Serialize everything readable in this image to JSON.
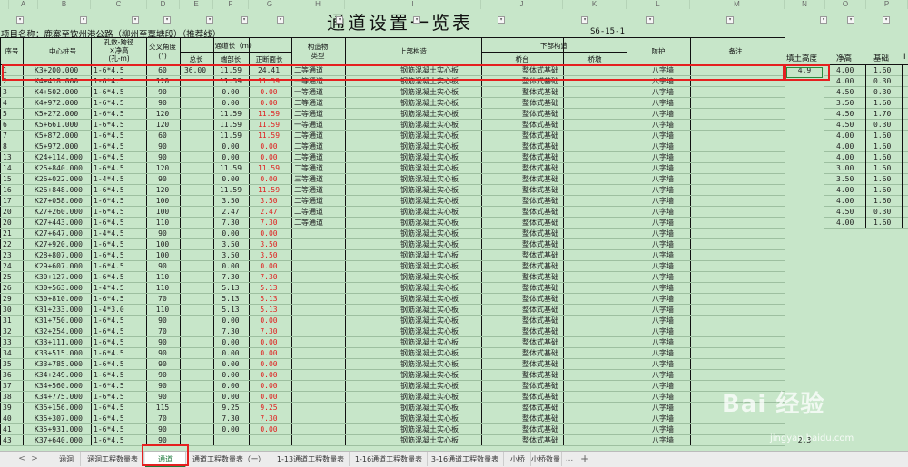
{
  "column_letters": [
    "A",
    "B",
    "C",
    "D",
    "E",
    "F",
    "G",
    "H",
    "I",
    "J",
    "K",
    "L",
    "M",
    "N",
    "O",
    "P"
  ],
  "title": "通道设置一览表",
  "project_label": "项目名称：鹿寨至钦州港公路（柳州至覃塘段）（推荐线）",
  "sheet_code": "S6-15-1",
  "headers": {
    "no": "序号",
    "station": "中心桩号",
    "span_l1": "孔数-跨径",
    "span_l2": "×净高",
    "span_l3": "(孔-m)",
    "angle_l1": "交叉角度",
    "angle_l2": "(°)",
    "length_group": "通道长（m）",
    "total": "总长",
    "mid": "端部长",
    "side": "正断面长",
    "type_l1": "构造物",
    "type_l2": "类型",
    "super": "上部构造",
    "sub_group": "下部构造",
    "abut": "桥台",
    "pier": "桥墩",
    "protect": "防护",
    "remark": "备注",
    "fill_height": "填土高度",
    "net_height": "净高",
    "foundation": "基础",
    "extra": "I"
  },
  "rows": [
    {
      "no": "1",
      "station": "K3+200.000",
      "span": "1-6*4.5",
      "angle": "60",
      "total": "36.00",
      "mid": "11.59",
      "side": "24.41",
      "type": "二等通道",
      "super": "钢筋混凝土实心板",
      "abut": "整体式基础",
      "protect": "八字墙",
      "fill": "4.9",
      "net": "4.00",
      "found": "1.60"
    },
    {
      "no": "2",
      "station": "K4+418.000",
      "span": "1-6*4.5",
      "angle": "120",
      "total": "",
      "mid": "11.59",
      "side": "11.59",
      "type": "一等通道",
      "super": "钢筋混凝土实心板",
      "abut": "整体式基础",
      "protect": "八字墙",
      "fill": "",
      "net": "4.00",
      "found": "0.30"
    },
    {
      "no": "3",
      "station": "K4+502.000",
      "span": "1-6*4.5",
      "angle": "90",
      "total": "",
      "mid": "0.00",
      "side": "0.00",
      "type": "一等通道",
      "super": "钢筋混凝土实心板",
      "abut": "整体式基础",
      "protect": "八字墙",
      "fill": "",
      "net": "4.50",
      "found": "0.30"
    },
    {
      "no": "4",
      "station": "K4+972.000",
      "span": "1-6*4.5",
      "angle": "90",
      "total": "",
      "mid": "0.00",
      "side": "0.00",
      "type": "二等通道",
      "super": "钢筋混凝土实心板",
      "abut": "整体式基础",
      "protect": "八字墙",
      "fill": "",
      "net": "3.50",
      "found": "1.60"
    },
    {
      "no": "5",
      "station": "K5+272.000",
      "span": "1-6*4.5",
      "angle": "120",
      "total": "",
      "mid": "11.59",
      "side": "11.59",
      "type": "二等通道",
      "super": "钢筋混凝土实心板",
      "abut": "整体式基础",
      "protect": "八字墙",
      "fill": "",
      "net": "4.50",
      "found": "1.70"
    },
    {
      "no": "6",
      "station": "K5+661.000",
      "span": "1-6*4.5",
      "angle": "120",
      "total": "",
      "mid": "11.59",
      "side": "11.59",
      "type": "一等通道",
      "super": "钢筋混凝土实心板",
      "abut": "整体式基础",
      "protect": "八字墙",
      "fill": "",
      "net": "4.50",
      "found": "0.30"
    },
    {
      "no": "7",
      "station": "K5+872.000",
      "span": "1-6*4.5",
      "angle": "60",
      "total": "",
      "mid": "11.59",
      "side": "11.59",
      "type": "二等通道",
      "super": "钢筋混凝土实心板",
      "abut": "整体式基础",
      "protect": "八字墙",
      "fill": "",
      "net": "4.00",
      "found": "1.60"
    },
    {
      "no": "8",
      "station": "K5+972.000",
      "span": "1-6*4.5",
      "angle": "90",
      "total": "",
      "mid": "0.00",
      "side": "0.00",
      "type": "二等通道",
      "super": "钢筋混凝土实心板",
      "abut": "整体式基础",
      "protect": "八字墙",
      "fill": "",
      "net": "4.00",
      "found": "1.60"
    },
    {
      "no": "13",
      "station": "K24+114.000",
      "span": "1-6*4.5",
      "angle": "90",
      "total": "",
      "mid": "0.00",
      "side": "0.00",
      "type": "二等通道",
      "super": "钢筋混凝土实心板",
      "abut": "整体式基础",
      "protect": "八字墙",
      "fill": "",
      "net": "4.00",
      "found": "1.60"
    },
    {
      "no": "14",
      "station": "K25+840.000",
      "span": "1-6*4.5",
      "angle": "120",
      "total": "",
      "mid": "11.59",
      "side": "11.59",
      "type": "二等通道",
      "super": "钢筋混凝土实心板",
      "abut": "整体式基础",
      "protect": "八字墙",
      "fill": "",
      "net": "3.00",
      "found": "1.50"
    },
    {
      "no": "15",
      "station": "K26+022.000",
      "span": "1-4*4.5",
      "angle": "90",
      "total": "",
      "mid": "0.00",
      "side": "0.00",
      "type": "三等通道",
      "super": "钢筋混凝土实心板",
      "abut": "整体式基础",
      "protect": "八字墙",
      "fill": "",
      "net": "3.50",
      "found": "1.60"
    },
    {
      "no": "16",
      "station": "K26+848.000",
      "span": "1-6*4.5",
      "angle": "120",
      "total": "",
      "mid": "11.59",
      "side": "11.59",
      "type": "二等通道",
      "super": "钢筋混凝土实心板",
      "abut": "整体式基础",
      "protect": "八字墙",
      "fill": "",
      "net": "4.00",
      "found": "1.60"
    },
    {
      "no": "17",
      "station": "K27+058.000",
      "span": "1-6*4.5",
      "angle": "100",
      "total": "",
      "mid": "3.50",
      "side": "3.50",
      "type": "二等通道",
      "super": "钢筋混凝土实心板",
      "abut": "整体式基础",
      "protect": "八字墙",
      "fill": "",
      "net": "4.00",
      "found": "1.60"
    },
    {
      "no": "20",
      "station": "K27+260.000",
      "span": "1-6*4.5",
      "angle": "100",
      "total": "",
      "mid": "2.47",
      "side": "2.47",
      "type": "二等通道",
      "super": "钢筋混凝土实心板",
      "abut": "整体式基础",
      "protect": "八字墙",
      "fill": "",
      "net": "4.50",
      "found": "0.30"
    },
    {
      "no": "20",
      "station": "K27+443.000",
      "span": "1-6*4.5",
      "angle": "110",
      "total": "",
      "mid": "7.30",
      "side": "7.30",
      "type": "二等通道",
      "super": "钢筋混凝土实心板",
      "abut": "整体式基础",
      "protect": "八字墙",
      "fill": "",
      "net": "4.00",
      "found": "1.60"
    },
    {
      "no": "21",
      "station": "K27+647.000",
      "span": "1-4*4.5",
      "angle": "90",
      "total": "",
      "mid": "0.00",
      "side": "0.00",
      "type": "",
      "super": "钢筋混凝土实心板",
      "abut": "整体式基础",
      "protect": "八字墙",
      "fill": "",
      "net": "",
      "found": ""
    },
    {
      "no": "22",
      "station": "K27+920.000",
      "span": "1-6*4.5",
      "angle": "100",
      "total": "",
      "mid": "3.50",
      "side": "3.50",
      "type": "",
      "super": "钢筋混凝土实心板",
      "abut": "整体式基础",
      "protect": "八字墙",
      "fill": "",
      "net": "",
      "found": ""
    },
    {
      "no": "23",
      "station": "K28+807.000",
      "span": "1-6*4.5",
      "angle": "100",
      "total": "",
      "mid": "3.50",
      "side": "3.50",
      "type": "",
      "super": "钢筋混凝土实心板",
      "abut": "整体式基础",
      "protect": "八字墙",
      "fill": "",
      "net": "",
      "found": ""
    },
    {
      "no": "24",
      "station": "K29+607.000",
      "span": "1-6*4.5",
      "angle": "90",
      "total": "",
      "mid": "0.00",
      "side": "0.00",
      "type": "",
      "super": "钢筋混凝土实心板",
      "abut": "整体式基础",
      "protect": "八字墙",
      "fill": "",
      "net": "",
      "found": ""
    },
    {
      "no": "25",
      "station": "K30+127.000",
      "span": "1-6*4.5",
      "angle": "110",
      "total": "",
      "mid": "7.30",
      "side": "7.30",
      "type": "",
      "super": "钢筋混凝土实心板",
      "abut": "整体式基础",
      "protect": "八字墙",
      "fill": "",
      "net": "",
      "found": ""
    },
    {
      "no": "26",
      "station": "K30+563.000",
      "span": "1-4*4.5",
      "angle": "110",
      "total": "",
      "mid": "5.13",
      "side": "5.13",
      "type": "",
      "super": "钢筋混凝土实心板",
      "abut": "整体式基础",
      "protect": "八字墙",
      "fill": "",
      "net": "",
      "found": ""
    },
    {
      "no": "29",
      "station": "K30+810.000",
      "span": "1-6*4.5",
      "angle": "70",
      "total": "",
      "mid": "5.13",
      "side": "5.13",
      "type": "",
      "super": "钢筋混凝土实心板",
      "abut": "整体式基础",
      "protect": "八字墙",
      "fill": "",
      "net": "",
      "found": ""
    },
    {
      "no": "30",
      "station": "K31+233.000",
      "span": "1-4*3.0",
      "angle": "110",
      "total": "",
      "mid": "5.13",
      "side": "5.13",
      "type": "",
      "super": "钢筋混凝土实心板",
      "abut": "整体式基础",
      "protect": "八字墙",
      "fill": "",
      "net": "",
      "found": ""
    },
    {
      "no": "31",
      "station": "K31+750.000",
      "span": "1-6*4.5",
      "angle": "90",
      "total": "",
      "mid": "0.00",
      "side": "0.00",
      "type": "",
      "super": "钢筋混凝土实心板",
      "abut": "整体式基础",
      "protect": "八字墙",
      "fill": "",
      "net": "",
      "found": ""
    },
    {
      "no": "32",
      "station": "K32+254.000",
      "span": "1-6*4.5",
      "angle": "70",
      "total": "",
      "mid": "7.30",
      "side": "7.30",
      "type": "",
      "super": "钢筋混凝土实心板",
      "abut": "整体式基础",
      "protect": "八字墙",
      "fill": "",
      "net": "",
      "found": ""
    },
    {
      "no": "33",
      "station": "K33+111.000",
      "span": "1-6*4.5",
      "angle": "90",
      "total": "",
      "mid": "0.00",
      "side": "0.00",
      "type": "",
      "super": "钢筋混凝土实心板",
      "abut": "整体式基础",
      "protect": "八字墙",
      "fill": "",
      "net": "",
      "found": ""
    },
    {
      "no": "34",
      "station": "K33+515.000",
      "span": "1-6*4.5",
      "angle": "90",
      "total": "",
      "mid": "0.00",
      "side": "0.00",
      "type": "",
      "super": "钢筋混凝土实心板",
      "abut": "整体式基础",
      "protect": "八字墙",
      "fill": "",
      "net": "",
      "found": ""
    },
    {
      "no": "35",
      "station": "K33+785.000",
      "span": "1-6*4.5",
      "angle": "90",
      "total": "",
      "mid": "0.00",
      "side": "0.00",
      "type": "",
      "super": "钢筋混凝土实心板",
      "abut": "整体式基础",
      "protect": "八字墙",
      "fill": "",
      "net": "",
      "found": ""
    },
    {
      "no": "36",
      "station": "K34+249.000",
      "span": "1-6*4.5",
      "angle": "90",
      "total": "",
      "mid": "0.00",
      "side": "0.00",
      "type": "",
      "super": "钢筋混凝土实心板",
      "abut": "整体式基础",
      "protect": "八字墙",
      "fill": "",
      "net": "",
      "found": ""
    },
    {
      "no": "37",
      "station": "K34+560.000",
      "span": "1-6*4.5",
      "angle": "90",
      "total": "",
      "mid": "0.00",
      "side": "0.00",
      "type": "",
      "super": "钢筋混凝土实心板",
      "abut": "整体式基础",
      "protect": "八字墙",
      "fill": "",
      "net": "",
      "found": ""
    },
    {
      "no": "38",
      "station": "K34+775.000",
      "span": "1-6*4.5",
      "angle": "90",
      "total": "",
      "mid": "0.00",
      "side": "0.00",
      "type": "",
      "super": "钢筋混凝土实心板",
      "abut": "整体式基础",
      "protect": "八字墙",
      "fill": "",
      "net": "",
      "found": ""
    },
    {
      "no": "39",
      "station": "K35+156.000",
      "span": "1-6*4.5",
      "angle": "115",
      "total": "",
      "mid": "9.25",
      "side": "9.25",
      "type": "",
      "super": "钢筋混凝土实心板",
      "abut": "整体式基础",
      "protect": "八字墙",
      "fill": "",
      "net": "",
      "found": ""
    },
    {
      "no": "40",
      "station": "K35+307.000",
      "span": "1-6*4.5",
      "angle": "70",
      "total": "",
      "mid": "7.30",
      "side": "7.30",
      "type": "",
      "super": "钢筋混凝土实心板",
      "abut": "整体式基础",
      "protect": "八字墙",
      "fill": "",
      "net": "",
      "found": ""
    },
    {
      "no": "41",
      "station": "K35+931.000",
      "span": "1-6*4.5",
      "angle": "90",
      "total": "",
      "mid": "0.00",
      "side": "0.00",
      "type": "",
      "super": "钢筋混凝土实心板",
      "abut": "整体式基础",
      "protect": "八字墙",
      "fill": "",
      "net": "",
      "found": ""
    },
    {
      "no": "43",
      "station": "K37+640.000",
      "span": "1-6*4.5",
      "angle": "90",
      "total": "",
      "mid": "",
      "side": "",
      "type": "",
      "super": "钢筋混凝土实心板",
      "abut": "整体式基础",
      "protect": "八字墙",
      "fill": "2.3",
      "net": "",
      "found": ""
    }
  ],
  "tabs": [
    "涵洞",
    "涵洞工程数量表",
    "通道",
    "通道工程数量表（一）",
    "1-13通道工程数量表",
    "1-16通道工程数量表",
    "3-16通道工程数量表",
    "小桥",
    "小桥数量"
  ],
  "active_tab": "通道",
  "tab_more": "...",
  "tab_add": "+",
  "nav_first": "<",
  "nav_last": ">",
  "watermark": "Bai 经验",
  "watermark_url": "jingyan.baidu.com",
  "colors": {
    "sheet_bg": "#c7e6c9",
    "highlight": "#e52020",
    "red_text": "#e02020",
    "active_tab": "#1e7a3c"
  }
}
